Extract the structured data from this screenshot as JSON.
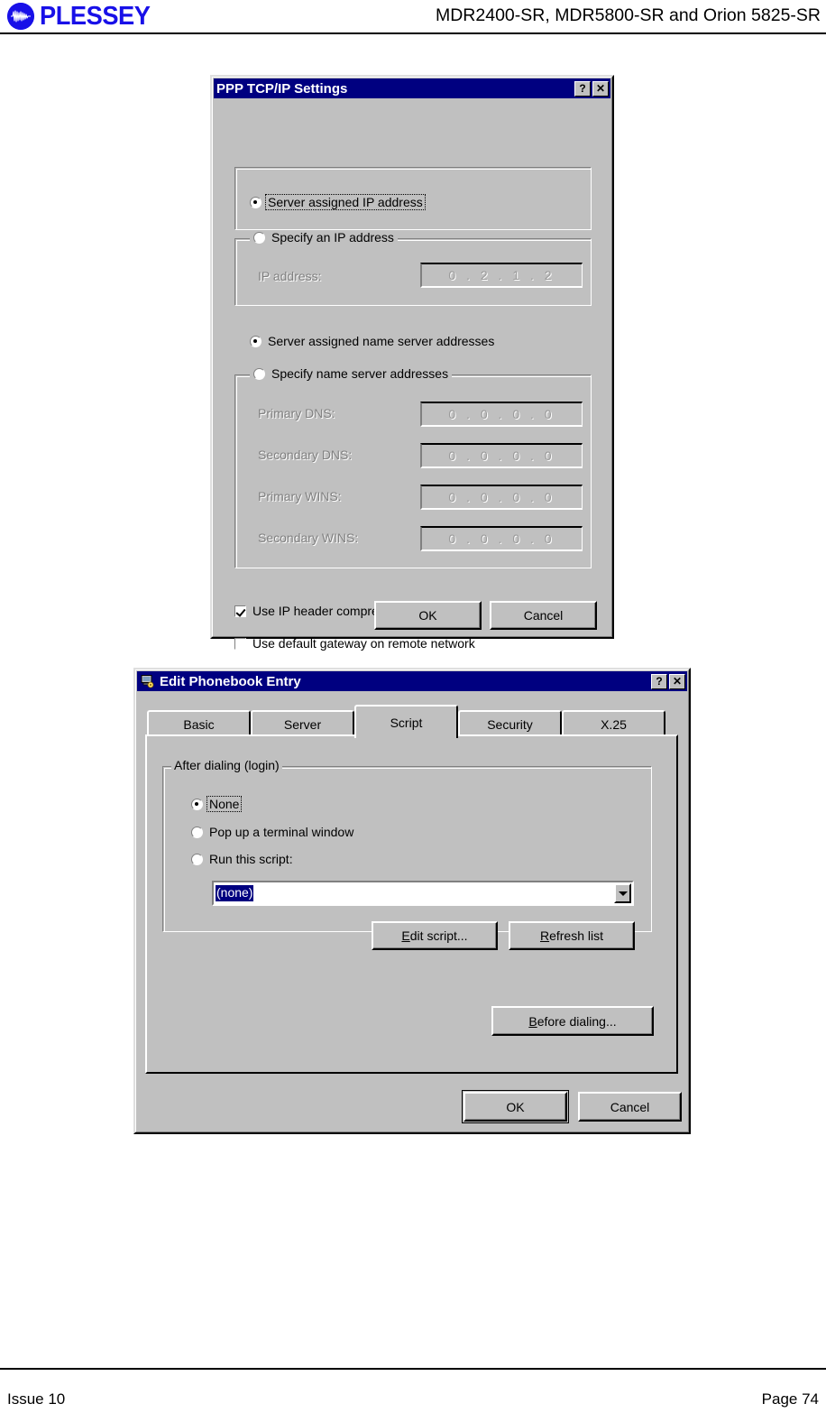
{
  "page_header": {
    "logo_text": "PLESSEY",
    "logo_icon": "plessey-waveform-circle-icon",
    "title": "MDR2400-SR, MDR5800-SR and Orion 5825-SR"
  },
  "footer": {
    "left": "Issue 10",
    "right": "Page 74"
  },
  "colors": {
    "titlebar": "#000080",
    "dialog_face": "#c0c0c0",
    "logo_blue": "#1810e8",
    "selection": "#000080",
    "disabled_text": "#808080"
  },
  "dialog_tcpip": {
    "title": "PPP TCP/IP Settings",
    "help_button": "?",
    "close_button": "✕",
    "radio_server_ip": {
      "label": "Server assigned IP address",
      "mnemonic": "S",
      "checked": true,
      "focused": true
    },
    "group_specify_ip": {
      "radio_label": "Specify an IP address",
      "mnemonic": "P",
      "checked": false,
      "field_label": "IP address:",
      "field_mnemonic": "a",
      "field_value": "0 . 2 . 1 . 2",
      "disabled": true
    },
    "radio_server_dns": {
      "label": "Server assigned name server addresses",
      "mnemonic": "e",
      "checked": true
    },
    "group_specify_dns": {
      "radio_label": "Specify name server addresses",
      "mnemonic": "m",
      "checked": false,
      "disabled": true,
      "fields": [
        {
          "label": "Primary DNS:",
          "mnemonic": "D",
          "value": "0 . 0 . 0 . 0"
        },
        {
          "label": "Secondary DNS:",
          "mnemonic": "N",
          "value": "0 . 0 . 0 . 0"
        },
        {
          "label": "Primary WINS:",
          "mnemonic": "W",
          "value": "0 . 0 . 0 . 0"
        },
        {
          "label": "Secondary WINS:",
          "mnemonic": "I",
          "value": "0 . 0 . 0 . 0"
        }
      ]
    },
    "checkbox_ip_header": {
      "label": "Use IP header compression",
      "mnemonic": "c",
      "checked": true
    },
    "checkbox_default_gateway": {
      "label": "Use default gateway on remote network",
      "mnemonic": "g",
      "checked": false
    },
    "ok_label": "OK",
    "cancel_label": "Cancel"
  },
  "dialog_phonebook": {
    "title": "Edit Phonebook Entry",
    "title_icon": "modem-phone-icon",
    "help_button": "?",
    "close_button": "✕",
    "tabs": [
      {
        "label": "Basic",
        "active": false
      },
      {
        "label": "Server",
        "active": false
      },
      {
        "label": "Script",
        "active": true
      },
      {
        "label": "Security",
        "active": false
      },
      {
        "label": "X.25",
        "active": false
      }
    ],
    "group_after_dialing": {
      "title": "After dialing (login)",
      "options": [
        {
          "label": "None",
          "mnemonic": "N",
          "checked": true,
          "focused": true
        },
        {
          "label": "Pop up a terminal window",
          "mnemonic": "t",
          "checked": false
        },
        {
          "label": "Run this script:",
          "mnemonic": "s",
          "checked": false
        }
      ],
      "script_combo_value": "(none)",
      "edit_script_label": "Edit script...",
      "edit_script_mnemonic": "E",
      "refresh_list_label": "Refresh list",
      "refresh_list_mnemonic": "R"
    },
    "before_dialing_label": "Before dialing...",
    "before_dialing_mnemonic": "B",
    "ok_label": "OK",
    "cancel_label": "Cancel"
  }
}
